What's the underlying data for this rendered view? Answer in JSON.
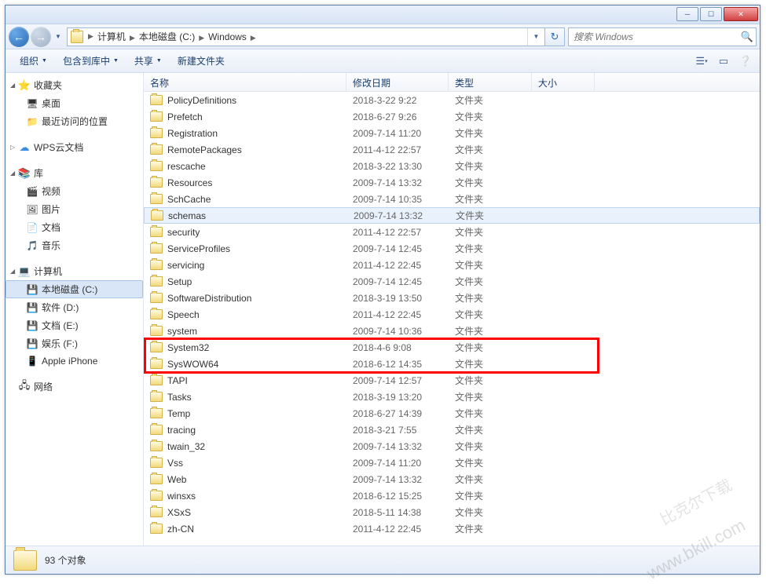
{
  "window": {
    "min_tip": "─",
    "max_tip": "☐",
    "close_tip": "✕"
  },
  "nav": {
    "back": "←",
    "fwd": "→",
    "refresh": "↻"
  },
  "breadcrumbs": [
    "计算机",
    "本地磁盘 (C:)",
    "Windows"
  ],
  "search": {
    "placeholder": "搜索 Windows"
  },
  "toolbar": {
    "organize": "组织",
    "include": "包含到库中",
    "share": "共享",
    "newfolder": "新建文件夹"
  },
  "sidebar": {
    "favorites": {
      "label": "收藏夹",
      "items": [
        "桌面",
        "最近访问的位置"
      ]
    },
    "wps": {
      "label": "WPS云文档"
    },
    "libraries": {
      "label": "库",
      "items": [
        "视频",
        "图片",
        "文档",
        "音乐"
      ]
    },
    "computer": {
      "label": "计算机",
      "items": [
        "本地磁盘 (C:)",
        "软件 (D:)",
        "文档 (E:)",
        "娱乐 (F:)",
        "Apple iPhone"
      ]
    },
    "network": {
      "label": "网络"
    }
  },
  "columns": {
    "name": "名称",
    "date": "修改日期",
    "type": "类型",
    "size": "大小"
  },
  "type_folder": "文件夹",
  "files": [
    {
      "n": "PolicyDefinitions",
      "d": "2018-3-22 9:22"
    },
    {
      "n": "Prefetch",
      "d": "2018-6-27 9:26"
    },
    {
      "n": "Registration",
      "d": "2009-7-14 11:20"
    },
    {
      "n": "RemotePackages",
      "d": "2011-4-12 22:57"
    },
    {
      "n": "rescache",
      "d": "2018-3-22 13:30"
    },
    {
      "n": "Resources",
      "d": "2009-7-14 13:32"
    },
    {
      "n": "SchCache",
      "d": "2009-7-14 10:35"
    },
    {
      "n": "schemas",
      "d": "2009-7-14 13:32",
      "hover": true
    },
    {
      "n": "security",
      "d": "2011-4-12 22:57"
    },
    {
      "n": "ServiceProfiles",
      "d": "2009-7-14 12:45"
    },
    {
      "n": "servicing",
      "d": "2011-4-12 22:45"
    },
    {
      "n": "Setup",
      "d": "2009-7-14 12:45"
    },
    {
      "n": "SoftwareDistribution",
      "d": "2018-3-19 13:50"
    },
    {
      "n": "Speech",
      "d": "2011-4-12 22:45"
    },
    {
      "n": "system",
      "d": "2009-7-14 10:36"
    },
    {
      "n": "System32",
      "d": "2018-4-6 9:08"
    },
    {
      "n": "SysWOW64",
      "d": "2018-6-12 14:35"
    },
    {
      "n": "TAPI",
      "d": "2009-7-14 12:57"
    },
    {
      "n": "Tasks",
      "d": "2018-3-19 13:20"
    },
    {
      "n": "Temp",
      "d": "2018-6-27 14:39"
    },
    {
      "n": "tracing",
      "d": "2018-3-21 7:55"
    },
    {
      "n": "twain_32",
      "d": "2009-7-14 13:32"
    },
    {
      "n": "Vss",
      "d": "2009-7-14 11:20"
    },
    {
      "n": "Web",
      "d": "2009-7-14 13:32"
    },
    {
      "n": "winsxs",
      "d": "2018-6-12 15:25"
    },
    {
      "n": "XSxS",
      "d": "2018-5-11 14:38"
    },
    {
      "n": "zh-CN",
      "d": "2011-4-12 22:45"
    }
  ],
  "highlight_rows": [
    15,
    16
  ],
  "status": {
    "count": "93 个对象"
  },
  "watermark1": "www.bkill.com",
  "watermark2": "比克尔下载"
}
